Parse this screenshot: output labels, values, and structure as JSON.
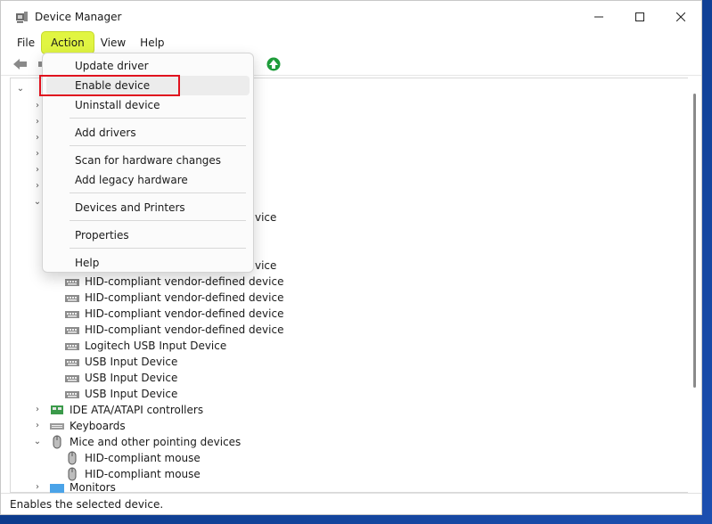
{
  "window": {
    "title": "Device Manager",
    "controls": {
      "minimize": "minimize",
      "maximize": "maximize",
      "close": "close"
    }
  },
  "menubar": {
    "items": [
      "File",
      "Action",
      "View",
      "Help"
    ],
    "active": "Action"
  },
  "action_menu": {
    "items": [
      {
        "label": "Update driver"
      },
      {
        "label": "Enable device",
        "highlighted": true
      },
      {
        "label": "Uninstall device"
      },
      {
        "label": "Add drivers"
      },
      {
        "label": "Scan for hardware changes"
      },
      {
        "label": "Add legacy hardware"
      },
      {
        "label": "Devices and Printers"
      },
      {
        "label": "Properties"
      },
      {
        "label": "Help"
      }
    ]
  },
  "tree": {
    "partial_label_1": "vice",
    "partial_label_2": "vice",
    "hid_children": [
      "HID-compliant vendor-defined device",
      "HID-compliant vendor-defined device",
      "HID-compliant vendor-defined device",
      "HID-compliant vendor-defined device",
      "Logitech USB Input Device",
      "USB Input Device",
      "USB Input Device",
      "USB Input Device"
    ],
    "ide": "IDE ATA/ATAPI controllers",
    "keyboards": "Keyboards",
    "mice": "Mice and other pointing devices",
    "mice_children": [
      "HID-compliant mouse",
      "HID-compliant mouse"
    ],
    "monitors": "Monitors"
  },
  "statusbar": {
    "text": "Enables the selected device."
  },
  "colors": {
    "accent_highlight": "#e1f542",
    "callout_red": "#e0121e",
    "toolbar_green": "#1e9c3a"
  }
}
